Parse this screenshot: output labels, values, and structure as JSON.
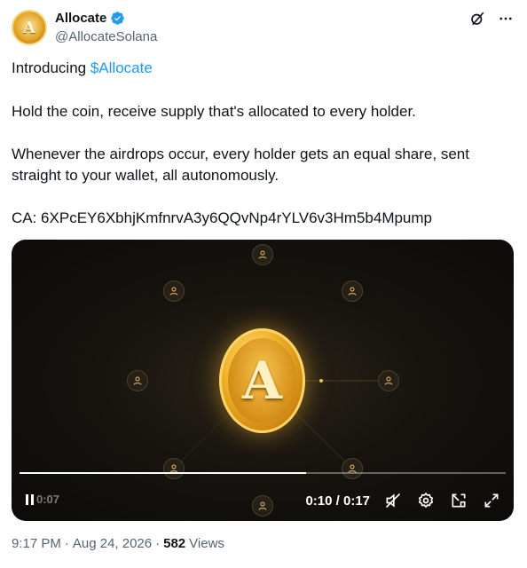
{
  "author": {
    "display_name": "Allocate",
    "handle": "@AllocateSolana",
    "avatar_letter": "A",
    "verified_icon": "verified-badge-icon"
  },
  "header_actions": [
    "grok-slash-icon",
    "more-icon"
  ],
  "post": {
    "intro_prefix": "Introducing ",
    "cashtag": "$Allocate",
    "paragraph1": "Hold the coin, receive supply that's allocated to every holder.",
    "paragraph2": "Whenever the airdrops occur, every holder gets an equal share, sent straight to your wallet, all autonomously.",
    "contract": "CA: 6XPcEY6XbhjKmfnrvA3y6QQvNp4rYLV6v3Hm5b4Mpump"
  },
  "video": {
    "coin_letter": "A",
    "ghost_time": "0:07",
    "time_display": "0:10 / 0:17",
    "progress": 0.59,
    "controls": [
      "mute-icon",
      "settings-icon",
      "popout-icon",
      "fullscreen-icon"
    ]
  },
  "meta": {
    "time": "9:17 PM",
    "separator": "·",
    "date": "Aug 24, 2026",
    "views_count": "582",
    "views_label": "Views"
  },
  "colors": {
    "link": "#1d9bf0",
    "secondary_text": "#536471",
    "coin_gold": "#f2b329"
  }
}
